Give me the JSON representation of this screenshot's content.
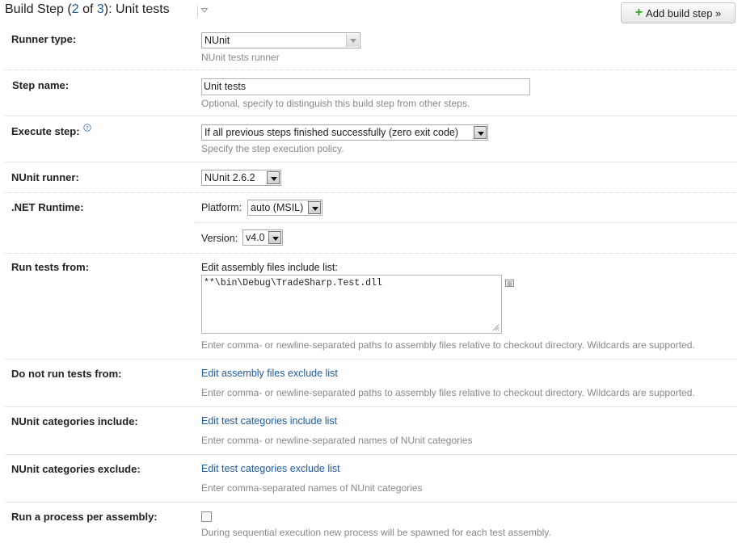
{
  "header": {
    "title_prefix": "Build Step (",
    "step_current": "2",
    "of_text": " of ",
    "step_total": "3",
    "title_suffix": "): Unit tests",
    "add_button_label": "Add build step »"
  },
  "fields": {
    "runner_type": {
      "label": "Runner type:",
      "value": "NUnit",
      "hint": "NUnit tests runner"
    },
    "step_name": {
      "label": "Step name:",
      "value": "Unit tests",
      "hint": "Optional, specify to distinguish this build step from other steps."
    },
    "execute_step": {
      "label": "Execute step:",
      "value": "If all previous steps finished successfully (zero exit code)",
      "hint": "Specify the step execution policy."
    },
    "nunit_runner": {
      "label": "NUnit runner:",
      "value": "NUnit 2.6.2"
    },
    "net_runtime": {
      "label": ".NET Runtime:",
      "platform_label": "Platform:",
      "platform_value": "auto (MSIL)",
      "version_label": "Version:",
      "version_value": "v4.0"
    },
    "run_tests_from": {
      "label": "Run tests from:",
      "caption": "Edit assembly files include list:",
      "value": "**\\bin\\Debug\\TradeSharp.Test.dll",
      "hint": "Enter comma- or newline-separated paths to assembly files relative to checkout directory. Wildcards are supported."
    },
    "do_not_run_tests_from": {
      "label": "Do not run tests from:",
      "link": "Edit assembly files exclude list",
      "hint": "Enter comma- or newline-separated paths to assembly files relative to checkout directory. Wildcards are supported."
    },
    "categories_include": {
      "label": "NUnit categories include:",
      "link": "Edit test categories include list",
      "hint": "Enter comma- or newline-separated names of NUnit categories"
    },
    "categories_exclude": {
      "label": "NUnit categories exclude:",
      "link": "Edit test categories exclude list",
      "hint": "Enter comma-separated names of NUnit categories"
    },
    "process_per_assembly": {
      "label": "Run a process per assembly:",
      "checked": false,
      "hint": "During sequential execution new process will be spawned for each test assembly."
    }
  },
  "icons": {
    "add": "plus-icon",
    "help": "question-circle-icon",
    "list": "list-icon",
    "title_menu": "chevron-down-icon",
    "resize": "resize-grip-icon"
  },
  "colors": {
    "link": "#1d5ba0",
    "hint": "#888888",
    "add_plus": "#3a9b2c"
  }
}
